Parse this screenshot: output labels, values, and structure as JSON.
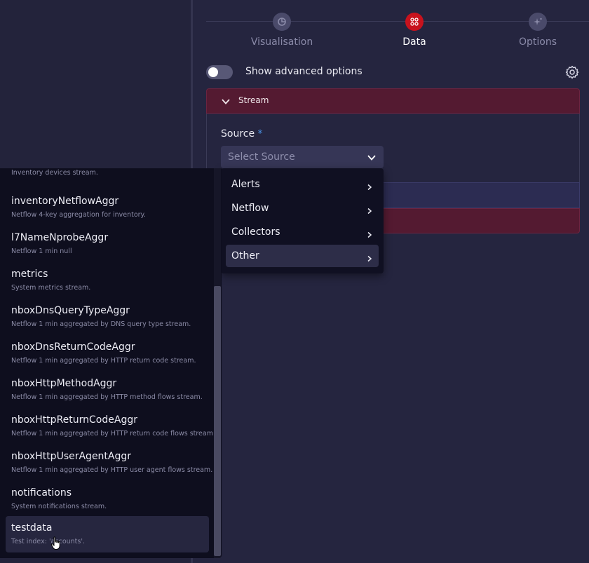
{
  "stepper": {
    "steps": [
      {
        "label": "Visualisation",
        "icon": "chart-pie-icon",
        "active": false
      },
      {
        "label": "Data",
        "icon": "data-nodes-icon",
        "active": true
      },
      {
        "label": "Options",
        "icon": "sparkle-icon",
        "active": false
      }
    ]
  },
  "advanced": {
    "label": "Show advanced options",
    "toggle_on": false
  },
  "stream": {
    "title": "Stream",
    "source_label": "Source",
    "required_mark": "*",
    "source_placeholder": "Select Source"
  },
  "source_menu": {
    "items": [
      "Alerts",
      "Netflow",
      "Collectors",
      "Other"
    ],
    "highlighted": "Other"
  },
  "stream_list": {
    "items": [
      {
        "name": "",
        "description": "Inventory devices stream."
      },
      {
        "name": "inventoryNetflowAggr",
        "description": "Netflow 4-key aggregation for inventory."
      },
      {
        "name": "l7NameNprobeAggr",
        "description": "Netflow 1 min null"
      },
      {
        "name": "metrics",
        "description": "System metrics stream."
      },
      {
        "name": "nboxDnsQueryTypeAggr",
        "description": "Netflow 1 min aggregated by DNS query type stream."
      },
      {
        "name": "nboxDnsReturnCodeAggr",
        "description": "Netflow 1 min aggregated by HTTP return code stream."
      },
      {
        "name": "nboxHttpMethodAggr",
        "description": "Netflow 1 min aggregated by HTTP method flows stream."
      },
      {
        "name": "nboxHttpReturnCodeAggr",
        "description": "Netflow 1 min aggregated by HTTP return code flows stream."
      },
      {
        "name": "nboxHttpUserAgentAggr",
        "description": "Netflow 1 min aggregated by HTTP user agent flows stream."
      },
      {
        "name": "notifications",
        "description": "System notifications stream."
      },
      {
        "name": "testdata",
        "description": "Test index: 'accounts'."
      }
    ],
    "selected": "testdata"
  },
  "colors": {
    "accent_red": "#c8121d",
    "stream_header": "#541a31",
    "required": "#4a90e2"
  }
}
